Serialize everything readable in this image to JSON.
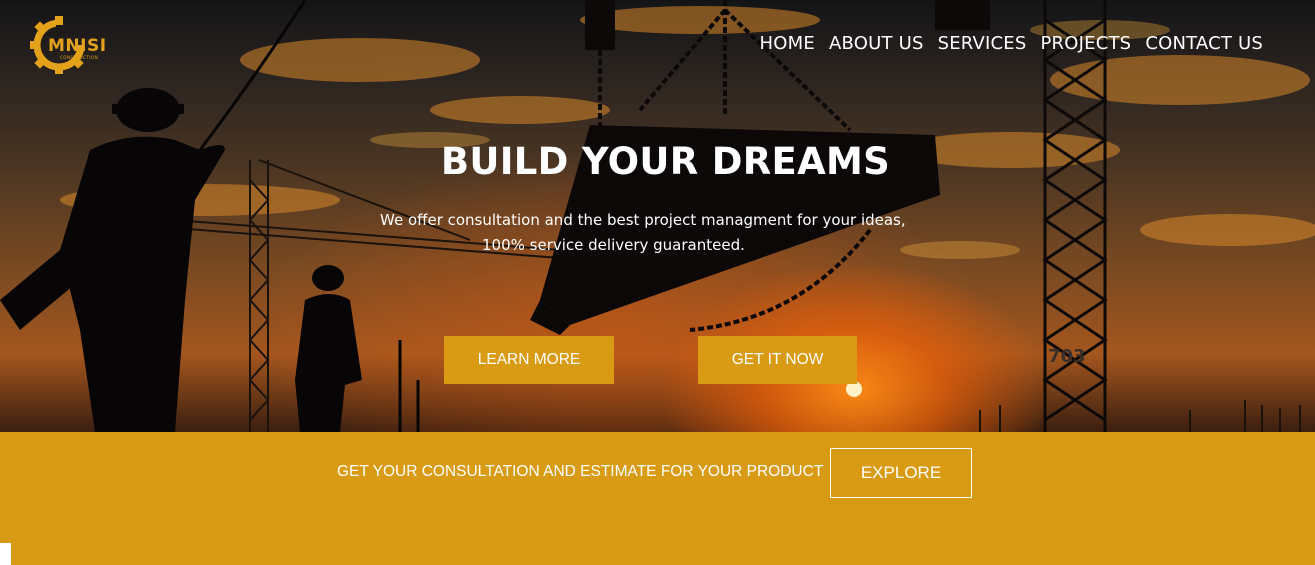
{
  "brand": {
    "name": "MNISI",
    "tagline": "CONSTRUCTION",
    "color": "#e4a21a"
  },
  "nav": {
    "items": [
      "HOME",
      "ABOUT US",
      "SERVICES",
      "PROJECTS",
      "CONTACT US"
    ]
  },
  "hero": {
    "headline": "BUILD YOUR DREAMS",
    "subtitle_line1": "We offer consultation and the best project managment for your ideas,",
    "subtitle_line2": "100% service delivery guaranteed.",
    "learn_more_label": "LEARN MORE",
    "get_it_now_label": "GET IT NOW"
  },
  "cta_band": {
    "text": "GET YOUR CONSULTATION AND ESTIMATE FOR YOUR PRODUCT",
    "explore_label": "EXPLORE"
  },
  "scene": {
    "crane_marking": "703"
  },
  "colors": {
    "accent": "#d99b14",
    "text": "#ffffff"
  }
}
